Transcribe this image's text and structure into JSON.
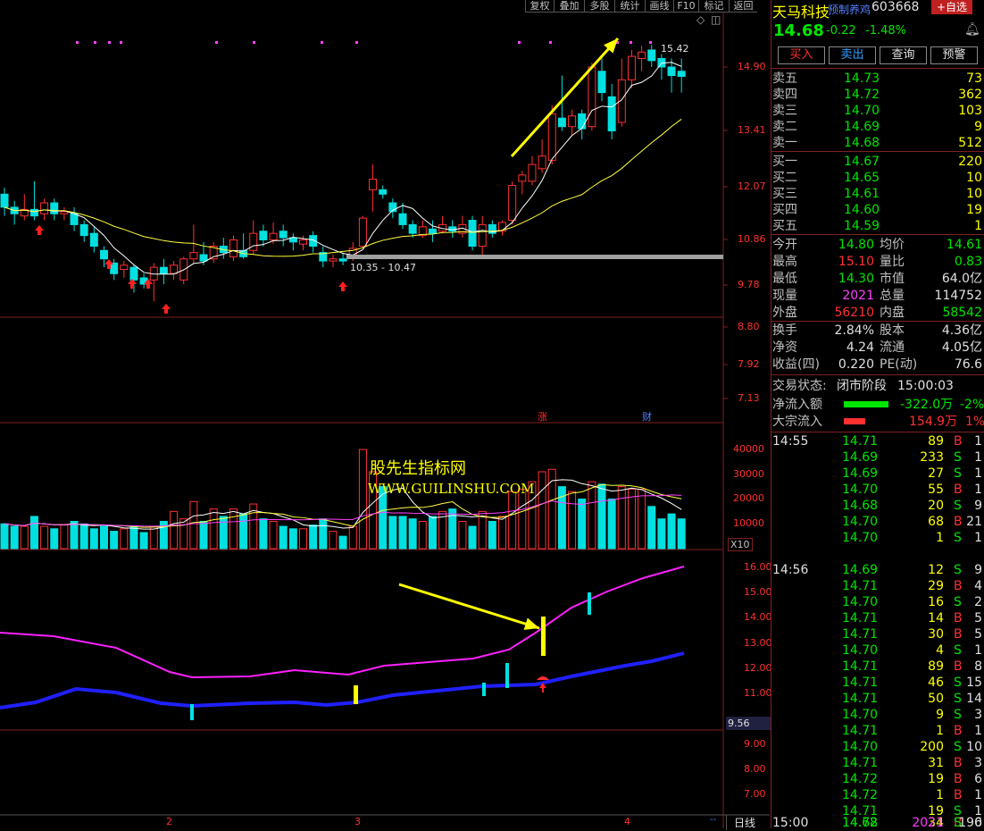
{
  "toolbar": {
    "items": [
      "复权",
      "叠加",
      "多股",
      "统计",
      "画线",
      "F10",
      "标记",
      "返回"
    ]
  },
  "main_chart": {
    "price_axis": [
      "14.90",
      "13.41",
      "12.07",
      "10.86",
      "9.78",
      "8.80",
      "7.92",
      "7.13"
    ],
    "high_label": "15.42",
    "support_label": "10.35 - 10.47",
    "event_tags": [
      "涨",
      "财"
    ],
    "date_labels": [
      "2",
      "3",
      "4"
    ],
    "period": "日线"
  },
  "volume_chart": {
    "axis": [
      "40000",
      "30000",
      "20000",
      "10000"
    ],
    "unit": "X10"
  },
  "indicator_chart": {
    "axis": [
      "16.00",
      "15.00",
      "14.00",
      "13.00",
      "12.00",
      "11.00",
      "9.56",
      "9.00",
      "8.00",
      "7.00"
    ],
    "current_value": "9.56"
  },
  "watermark": {
    "line1": "股先生指标网",
    "line2": "WWW.GUILINSHU.COM"
  },
  "quote": {
    "name": "天马科技",
    "tag": "预制养鸡",
    "code": "603668",
    "add_button": "+自选",
    "price": "14.68",
    "change": "-0.22",
    "change_pct": "-1.48%",
    "buttons": [
      "买入",
      "卖出",
      "查询",
      "预警"
    ],
    "asks": [
      {
        "label": "卖五",
        "price": "14.73",
        "vol": "73"
      },
      {
        "label": "卖四",
        "price": "14.72",
        "vol": "362"
      },
      {
        "label": "卖三",
        "price": "14.70",
        "vol": "103"
      },
      {
        "label": "卖二",
        "price": "14.69",
        "vol": "9"
      },
      {
        "label": "卖一",
        "price": "14.68",
        "vol": "512"
      }
    ],
    "bids": [
      {
        "label": "买一",
        "price": "14.67",
        "vol": "220"
      },
      {
        "label": "买二",
        "price": "14.65",
        "vol": "10"
      },
      {
        "label": "买三",
        "price": "14.61",
        "vol": "10"
      },
      {
        "label": "买四",
        "price": "14.60",
        "vol": "19"
      },
      {
        "label": "买五",
        "price": "14.59",
        "vol": "1"
      }
    ],
    "stats": [
      {
        "l1": "今开",
        "v1": "14.80",
        "l2": "均价",
        "v2": "14.61"
      },
      {
        "l1": "最高",
        "v1": "15.10",
        "l2": "量比",
        "v2": "0.83"
      },
      {
        "l1": "最低",
        "v1": "14.30",
        "l2": "市值",
        "v2": "64.0亿"
      },
      {
        "l1": "现量",
        "v1": "2021",
        "l2": "总量",
        "v2": "114752"
      },
      {
        "l1": "外盘",
        "v1": "56210",
        "l2": "内盘",
        "v2": "58542"
      }
    ],
    "fund": [
      {
        "l1": "换手",
        "v1": "2.84%",
        "l2": "股本",
        "v2": "4.36亿"
      },
      {
        "l1": "净资",
        "v1": "4.24",
        "l2": "流通",
        "v2": "4.05亿"
      },
      {
        "l1": "收益(四)",
        "v1": "0.220",
        "l2": "PE(动)",
        "v2": "76.6"
      }
    ],
    "trade_status_label": "交易状态:",
    "trade_status": "闭市阶段",
    "trade_time": "15:00:03",
    "flows": [
      {
        "label": "净流入额",
        "value": "-322.0万",
        "pct": "-2%"
      },
      {
        "label": "大宗流入",
        "value": "154.9万",
        "pct": "1%"
      }
    ]
  },
  "ticks": [
    {
      "time": "14:55",
      "price": "14.71",
      "vol": "89",
      "side": "B",
      "n": "1"
    },
    {
      "time": "",
      "price": "14.69",
      "vol": "233",
      "side": "S",
      "n": "1"
    },
    {
      "time": "",
      "price": "14.69",
      "vol": "27",
      "side": "S",
      "n": "1"
    },
    {
      "time": "",
      "price": "14.70",
      "vol": "55",
      "side": "B",
      "n": "1"
    },
    {
      "time": "",
      "price": "14.68",
      "vol": "20",
      "side": "S",
      "n": "9"
    },
    {
      "time": "",
      "price": "14.70",
      "vol": "68",
      "side": "B",
      "n": "21"
    },
    {
      "time": "",
      "price": "14.70",
      "vol": "1",
      "side": "S",
      "n": "1"
    },
    {
      "time": "14:56",
      "price": "14.69",
      "vol": "12",
      "side": "S",
      "n": "9"
    },
    {
      "time": "",
      "price": "14.71",
      "vol": "29",
      "side": "B",
      "n": "4"
    },
    {
      "time": "",
      "price": "14.70",
      "vol": "16",
      "side": "S",
      "n": "2"
    },
    {
      "time": "",
      "price": "14.71",
      "vol": "14",
      "side": "B",
      "n": "5"
    },
    {
      "time": "",
      "price": "14.71",
      "vol": "30",
      "side": "B",
      "n": "5"
    },
    {
      "time": "",
      "price": "14.70",
      "vol": "4",
      "side": "S",
      "n": "1"
    },
    {
      "time": "",
      "price": "14.71",
      "vol": "89",
      "side": "B",
      "n": "8"
    },
    {
      "time": "",
      "price": "14.71",
      "vol": "46",
      "side": "S",
      "n": "15"
    },
    {
      "time": "",
      "price": "14.71",
      "vol": "50",
      "side": "S",
      "n": "14"
    },
    {
      "time": "",
      "price": "14.70",
      "vol": "9",
      "side": "S",
      "n": "3"
    },
    {
      "time": "",
      "price": "14.71",
      "vol": "1",
      "side": "B",
      "n": "1"
    },
    {
      "time": "",
      "price": "14.70",
      "vol": "200",
      "side": "S",
      "n": "10"
    },
    {
      "time": "",
      "price": "14.71",
      "vol": "31",
      "side": "B",
      "n": "3"
    },
    {
      "time": "",
      "price": "14.72",
      "vol": "19",
      "side": "B",
      "n": "6"
    },
    {
      "time": "",
      "price": "14.72",
      "vol": "1",
      "side": "B",
      "n": "1"
    },
    {
      "time": "",
      "price": "14.71",
      "vol": "19",
      "side": "S",
      "n": "1"
    },
    {
      "time": "",
      "price": "14.72",
      "vol": "34",
      "side": "B",
      "n": "6"
    },
    {
      "time": "15:00",
      "price": "14.68",
      "vol": "2021",
      "side": "S",
      "n": "190"
    }
  ],
  "colors": {
    "up": "#ff3030",
    "down": "#00e0e0",
    "ma5": "#ffffff",
    "ma20": "#ffff40",
    "indicator_top": "#ff20ff",
    "indicator_bottom": "#2020ff"
  }
}
